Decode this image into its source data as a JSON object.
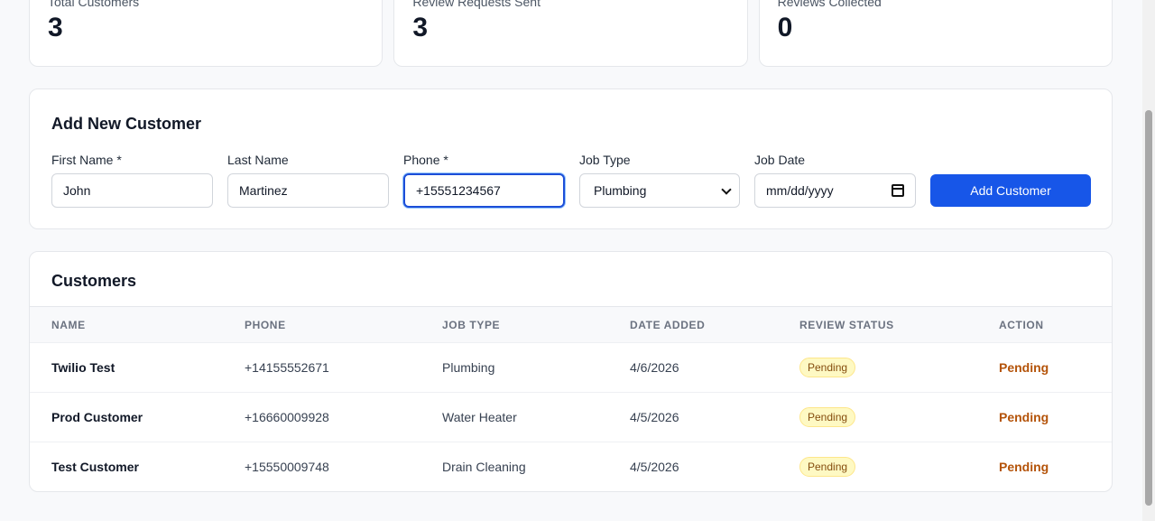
{
  "stats": [
    {
      "label": "Total Customers",
      "value": "3"
    },
    {
      "label": "Review Requests Sent",
      "value": "3"
    },
    {
      "label": "Reviews Collected",
      "value": "0"
    }
  ],
  "add_form": {
    "title": "Add New Customer",
    "first_name": {
      "label": "First Name *",
      "value": "John"
    },
    "last_name": {
      "label": "Last Name",
      "value": "Martinez"
    },
    "phone": {
      "label": "Phone *",
      "value": "+15551234567"
    },
    "job_type": {
      "label": "Job Type",
      "value": "Plumbing"
    },
    "job_date": {
      "label": "Job Date",
      "placeholder": "mm/dd/yyyy"
    },
    "submit_label": "Add Customer"
  },
  "customers": {
    "title": "Customers",
    "columns": [
      "NAME",
      "PHONE",
      "JOB TYPE",
      "DATE ADDED",
      "REVIEW STATUS",
      "ACTION"
    ],
    "rows": [
      {
        "name": "Twilio Test",
        "phone": "+14155552671",
        "job_type": "Plumbing",
        "date_added": "4/6/2026",
        "status": "Pending",
        "action": "Pending"
      },
      {
        "name": "Prod Customer",
        "phone": "+16660009928",
        "job_type": "Water Heater",
        "date_added": "4/5/2026",
        "status": "Pending",
        "action": "Pending"
      },
      {
        "name": "Test Customer",
        "phone": "+15550009748",
        "job_type": "Drain Cleaning",
        "date_added": "4/5/2026",
        "status": "Pending",
        "action": "Pending"
      }
    ]
  },
  "colors": {
    "accent": "#1756e8",
    "pending_badge_bg": "#fef9c3",
    "pending_text": "#b45309"
  }
}
